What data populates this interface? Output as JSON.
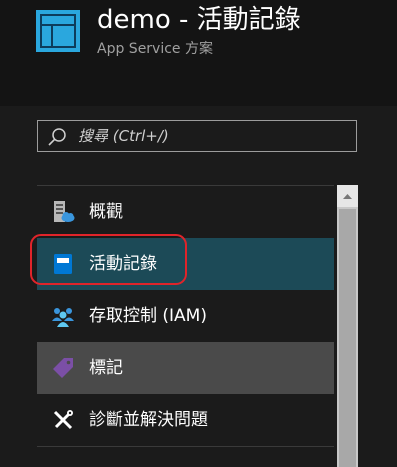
{
  "header": {
    "title": "demo - 活動記錄",
    "subtitle": "App Service 方案"
  },
  "search": {
    "placeholder": "搜尋 (Ctrl+/)"
  },
  "menu": {
    "items": [
      {
        "label": "概觀",
        "icon": "overview-icon",
        "state": "normal"
      },
      {
        "label": "活動記錄",
        "icon": "activity-log-icon",
        "state": "selected"
      },
      {
        "label": "存取控制 (IAM)",
        "icon": "access-control-icon",
        "state": "normal"
      },
      {
        "label": "標記",
        "icon": "tag-icon",
        "state": "hovered"
      },
      {
        "label": "診斷並解決問題",
        "icon": "wrench-screwdriver-icon",
        "state": "normal"
      }
    ]
  },
  "colors": {
    "selected_bg": "#1c4a57",
    "hover_bg": "#4a4a4a",
    "highlight_outline": "#e0242a",
    "accent_blue": "#0078d4"
  }
}
